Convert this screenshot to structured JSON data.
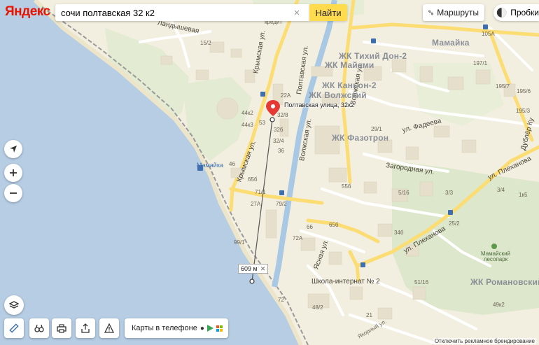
{
  "app": {
    "logo": "Яндекс",
    "search_query": "сочи полтавская 32 к2",
    "search_button": "Найти",
    "routes_label": "Маршруты",
    "traffic_label": "Пробки",
    "app_promo": "Карты в телефоне",
    "ruler_distance": "609 м",
    "footer_note": "Отключить рекламное брендирование"
  },
  "marker": {
    "label": "Полтавская улица, 32к2"
  },
  "labels": {
    "street_landysh": "Ландышевая",
    "street_krymskaya_top": "Крымская ул.",
    "street_krymskaya": "Крымская ул.",
    "street_poltavskaya": "Полтавская ул.",
    "street_volzhskaya": "Волжская ул.",
    "street_volzhskaya2": "Волжская ул.",
    "street_fadeeva": "ул. Фадеева",
    "street_zagorodnaya": "Загородная ул.",
    "street_plekhanova": "ул. Плеханова",
    "street_plekhanova2": "ул. Плеханова",
    "street_yasnaya": "Ясная ул.",
    "street_dubler": "Дублёр Ку",
    "street_yakornyi": "Якорный ул.",
    "complex_tikhiy_don": "ЖК Тихий Дон-2",
    "complex_maimi": "ЖК Майами",
    "complex_kanon": "ЖК Каньон-2",
    "complex_volzhsky": "ЖК Волжский",
    "complex_fazotron": "ЖК Фазотрон",
    "complex_romanovsky": "ЖК Романовский",
    "district_mamaika": "Мамайка",
    "station_mamaika": "Мамайка",
    "kredit": "кредит",
    "school": "Школа-интернат № 2",
    "park": "Мамайский лесопарк",
    "n_105a": "105А",
    "n_195_7": "195/7",
    "n_195_6": "195/6",
    "n_195_3": "195/3",
    "n_197_1": "197/1",
    "n_15_2": "15/2",
    "n_44k2": "44к2",
    "n_44k3": "44к3",
    "n_53": "53",
    "n_32b": "32б",
    "n_32_4": "32/4",
    "n_32_8": "32/8",
    "n_22a": "22А",
    "n_36": "36",
    "n_46": "46",
    "n_65b": "65б",
    "n_71": "71/1",
    "n_27a": "27А",
    "n_79_2": "79/2",
    "n_99_1": "99/1",
    "n_55b": "55б",
    "n_66": "66",
    "n_65b2": "65б",
    "n_72a": "72А",
    "n_29_1": "29/1",
    "n_5_16": "5/16",
    "n_3_3": "3/3",
    "n_34b": "34б",
    "n_25_2": "25/2",
    "n_3_4": "3/4",
    "n_1k5": "1к5",
    "n_51_16": "51/16",
    "n_49k2": "49к2",
    "n_48_2": "48/2",
    "n_72": "72",
    "n_21": "21"
  },
  "colors": {
    "water": "#b6cde4",
    "land": "#f3efe0",
    "park": "#dde7cb",
    "road_yellow": "#fbdd73",
    "road_white": "#ffffff",
    "river": "#a8c8e4",
    "marker_red": "#e53935",
    "find_yellow": "#ffdb4d"
  },
  "icons": [
    "locate-icon",
    "zoom-in-icon",
    "zoom-out-icon",
    "layers-icon",
    "ruler-icon",
    "binoculars-icon",
    "print-icon",
    "share-icon",
    "warning-icon",
    "routes-icon",
    "traffic-icon",
    "place-marker-icon"
  ]
}
